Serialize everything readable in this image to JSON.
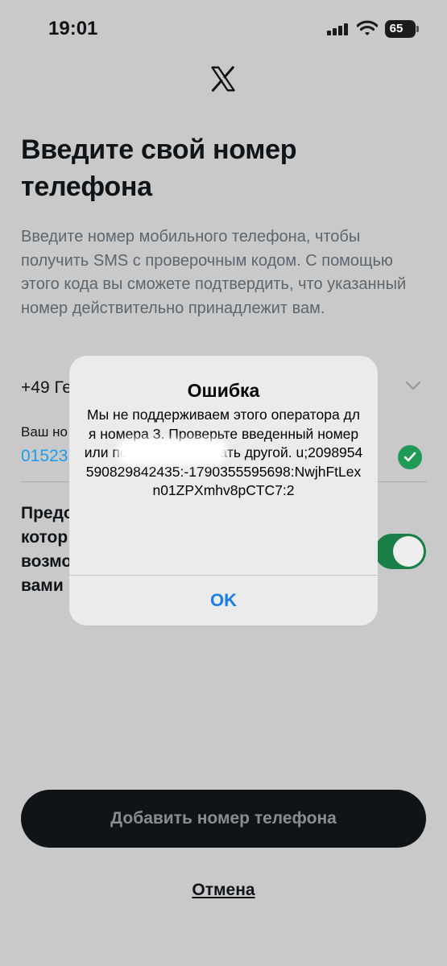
{
  "status_bar": {
    "time": "19:01",
    "battery": "65"
  },
  "page": {
    "title": "Введите свой номер телефона",
    "description": "Введите номер мобильного телефона, чтобы получить SMS с проверочным кодом. С помощью этого кода вы сможете подтвердить, что указанный номер действительно принадлежит вам.",
    "country_visible": "+49 Ге",
    "phone_label_visible": "Ваш но",
    "phone_value_visible": "01523",
    "consent_visible": "Предо\nкотор\nвозмо\nвами",
    "add_button": "Добавить номер телефона",
    "cancel_link": "Отмена"
  },
  "alert": {
    "title": "Ошибка",
    "message": "Мы не поддерживаем этого оператора для номера                        3. Проверьте введенный номер или попробуйте указать другой. u;2098954590829842435:-1790355595698:NwjhFtLexn01ZPXmhv8pCTC7:2",
    "ok": "OK"
  },
  "colors": {
    "background": "#c9c9c9",
    "accent_blue": "#1d9bf0",
    "ok_blue": "#1a7ee6",
    "toggle_green": "#1a7f47",
    "check_green": "#1f9b55",
    "button_dark": "#0f1419"
  },
  "icons": [
    "signal-icon",
    "wifi-icon",
    "battery-icon",
    "x-logo-icon",
    "chevron-down-icon",
    "check-icon"
  ]
}
